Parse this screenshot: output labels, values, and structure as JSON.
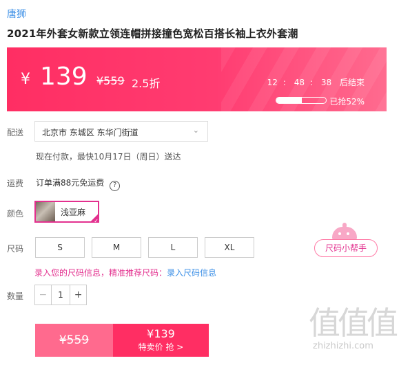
{
  "brand": "唐狮",
  "title": "2021年外套女新款立领连帽拼接撞色宽松百搭长袖上衣外套潮",
  "banner": {
    "yen": "¥",
    "price": "139",
    "original": "¥559",
    "discount": "2.5折",
    "timer_h": "12",
    "timer_m": "48",
    "timer_s": "38",
    "timer_suffix": "后结束",
    "sold_text": "已抢52%",
    "sold_fraction": 0.52,
    "color": "#ff2e63"
  },
  "delivery": {
    "label": "配送",
    "address": "北京市 东城区 东华门街道",
    "chevron_icon": "chevron-down-icon",
    "eta": "现在付款，最快10月17日（周日）送达"
  },
  "shipping": {
    "label": "运费",
    "text": "订单满88元免运费",
    "help_icon": "question-circle-icon",
    "help_glyph": "?"
  },
  "color": {
    "label": "颜色",
    "selected": "浅亚麻",
    "accent": "#e3308e"
  },
  "size": {
    "label": "尺码",
    "options": [
      "S",
      "M",
      "L",
      "XL"
    ],
    "helper": "尺码小帮手",
    "tip_prefix": "录入您的尺码信息，精准推荐尺码：",
    "tip_link": "录入尺码信息"
  },
  "quantity": {
    "label": "数量",
    "value": "1",
    "minus": "−",
    "plus": "+"
  },
  "buy": {
    "original": "¥559",
    "price": "¥139",
    "action": "特卖价 抢 >"
  },
  "watermark": {
    "big": "值值值",
    "small": "zhizhizhi.com"
  }
}
